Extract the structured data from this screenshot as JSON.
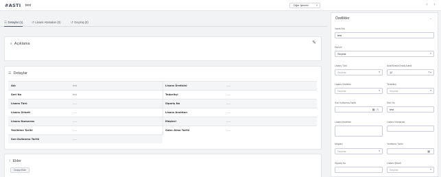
{
  "header": {
    "logo": "#ASTI",
    "title": "test",
    "other_actions": "Diğer İşlemler",
    "prev": "‹",
    "next": "›"
  },
  "tabs": [
    {
      "label": "Detaylar (1)",
      "active": true
    },
    {
      "label": "Lisans Atamaları (0)",
      "active": false
    },
    {
      "label": "Geçmiş (0)",
      "active": false
    }
  ],
  "description": {
    "title": "Açıklama"
  },
  "details": {
    "title": "Detaylar",
    "rows": [
      {
        "l1": "Adı",
        "v1": "test",
        "l2": "Lisans Üreticisi",
        "v2": "-----"
      },
      {
        "l1": "Seri No",
        "v1": "test",
        "l2": "Tedarikçi",
        "v2": "-----"
      },
      {
        "l1": "Lisans Türü",
        "v1": "-----",
        "l2": "Sipariş No",
        "v2": "-----"
      },
      {
        "l1": "Lisans Şirketi",
        "v1": "-----",
        "l2": "Lisans Anahtarı",
        "v2": "-----"
      },
      {
        "l1": "Lisans Numarası",
        "v1": "-----",
        "l2": "Müşteri",
        "v2": "-----"
      },
      {
        "l1": "Yenileme Tarihi",
        "v1": "-----",
        "l2": "Satın Alma Tarihi",
        "v2": "-----"
      },
      {
        "l1": "Son Kullanma Tarihi",
        "v1": "-----",
        "l2": "",
        "v2": ""
      }
    ]
  },
  "attachments": {
    "title": "Ekler",
    "add_label": "Dosya Ekle"
  },
  "properties": {
    "title": "Özellikler",
    "name_label": "Varlık Adı",
    "name_value": "test",
    "status_label": "Durum",
    "status_value": "Seçiniz",
    "license_type_label": "Lisans Türü",
    "license_type_value": "Seçiniz",
    "count_label": "Ana/Kiralık/Ortak Adedi",
    "count_value": "12",
    "maker_label": "Lisans Üreticisi",
    "maker_value": "Seçiniz",
    "supplier_label": "Tedarikçi",
    "supplier_value": "Seçiniz",
    "expiry_label": "Son Kullanma Tarihi",
    "serial_label": "Seri No",
    "serial_value": "test",
    "key_label": "Lisans Anahtarı",
    "number_label": "Lisans Numarası",
    "customer_label": "Müşteri",
    "customer_value": "Seçiniz",
    "renewal_label": "Yenileme Tarihi",
    "order_label": "Sipariş No",
    "company_label": "Lisans Şirketi",
    "company_value": "Seçiniz"
  }
}
